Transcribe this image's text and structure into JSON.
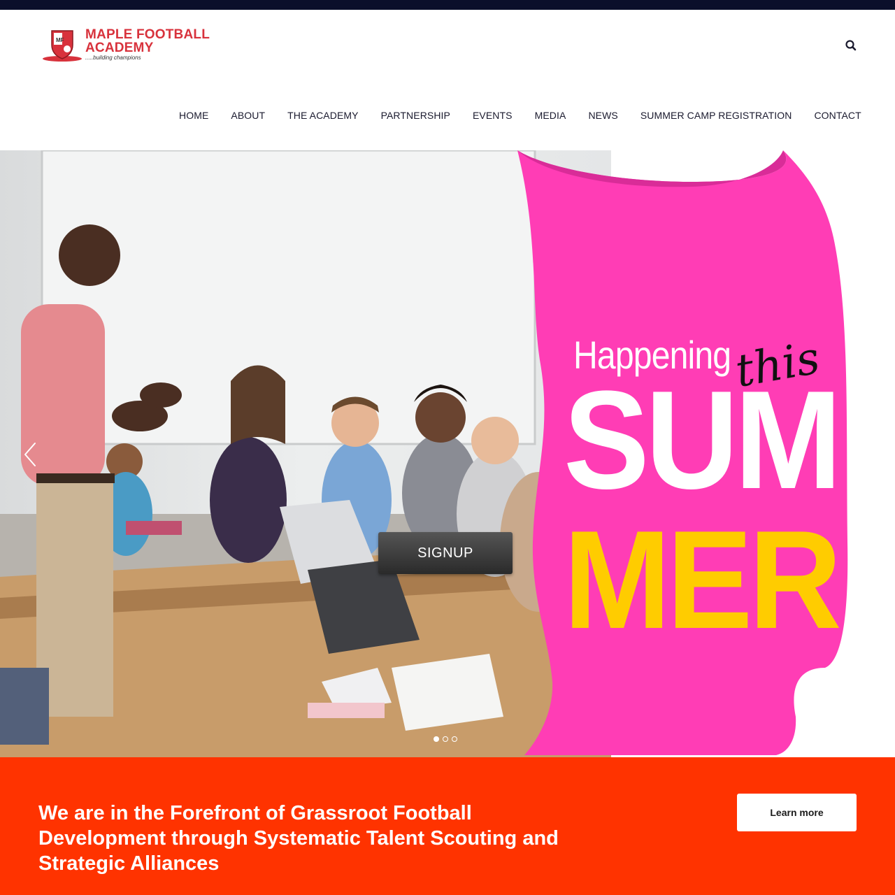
{
  "header": {
    "logo": {
      "title": "MAPLE FOOTBALL ACADEMY",
      "tagline": ".....building champions",
      "crest_letters": "MF"
    },
    "search_icon": "search-icon"
  },
  "nav": {
    "items": [
      {
        "label": "HOME"
      },
      {
        "label": "ABOUT"
      },
      {
        "label": "THE ACADEMY"
      },
      {
        "label": "PARTNERSHIP"
      },
      {
        "label": "EVENTS"
      },
      {
        "label": "MEDIA"
      },
      {
        "label": "NEWS"
      },
      {
        "label": "SUMMER CAMP REGISTRATION"
      },
      {
        "label": "CONTACT"
      }
    ]
  },
  "hero": {
    "banner": {
      "happening": "Happening",
      "this": "this",
      "sum": "SUM",
      "mer": "MER"
    },
    "signup_label": "SIGNUP",
    "prev_icon": "chevron-left-icon",
    "slides_total": 3,
    "active_slide": 1
  },
  "cta": {
    "text": "We are in the Forefront of Grassroot Football Development through Systematic Talent Scouting and Strategic Alliances",
    "button_label": "Learn more"
  },
  "colors": {
    "topbar": "#0b0f2b",
    "brand_red": "#d8323c",
    "banner_pink": "#ff3db5",
    "summer_yellow": "#ffcc00",
    "cta_orange": "#ff3300"
  }
}
